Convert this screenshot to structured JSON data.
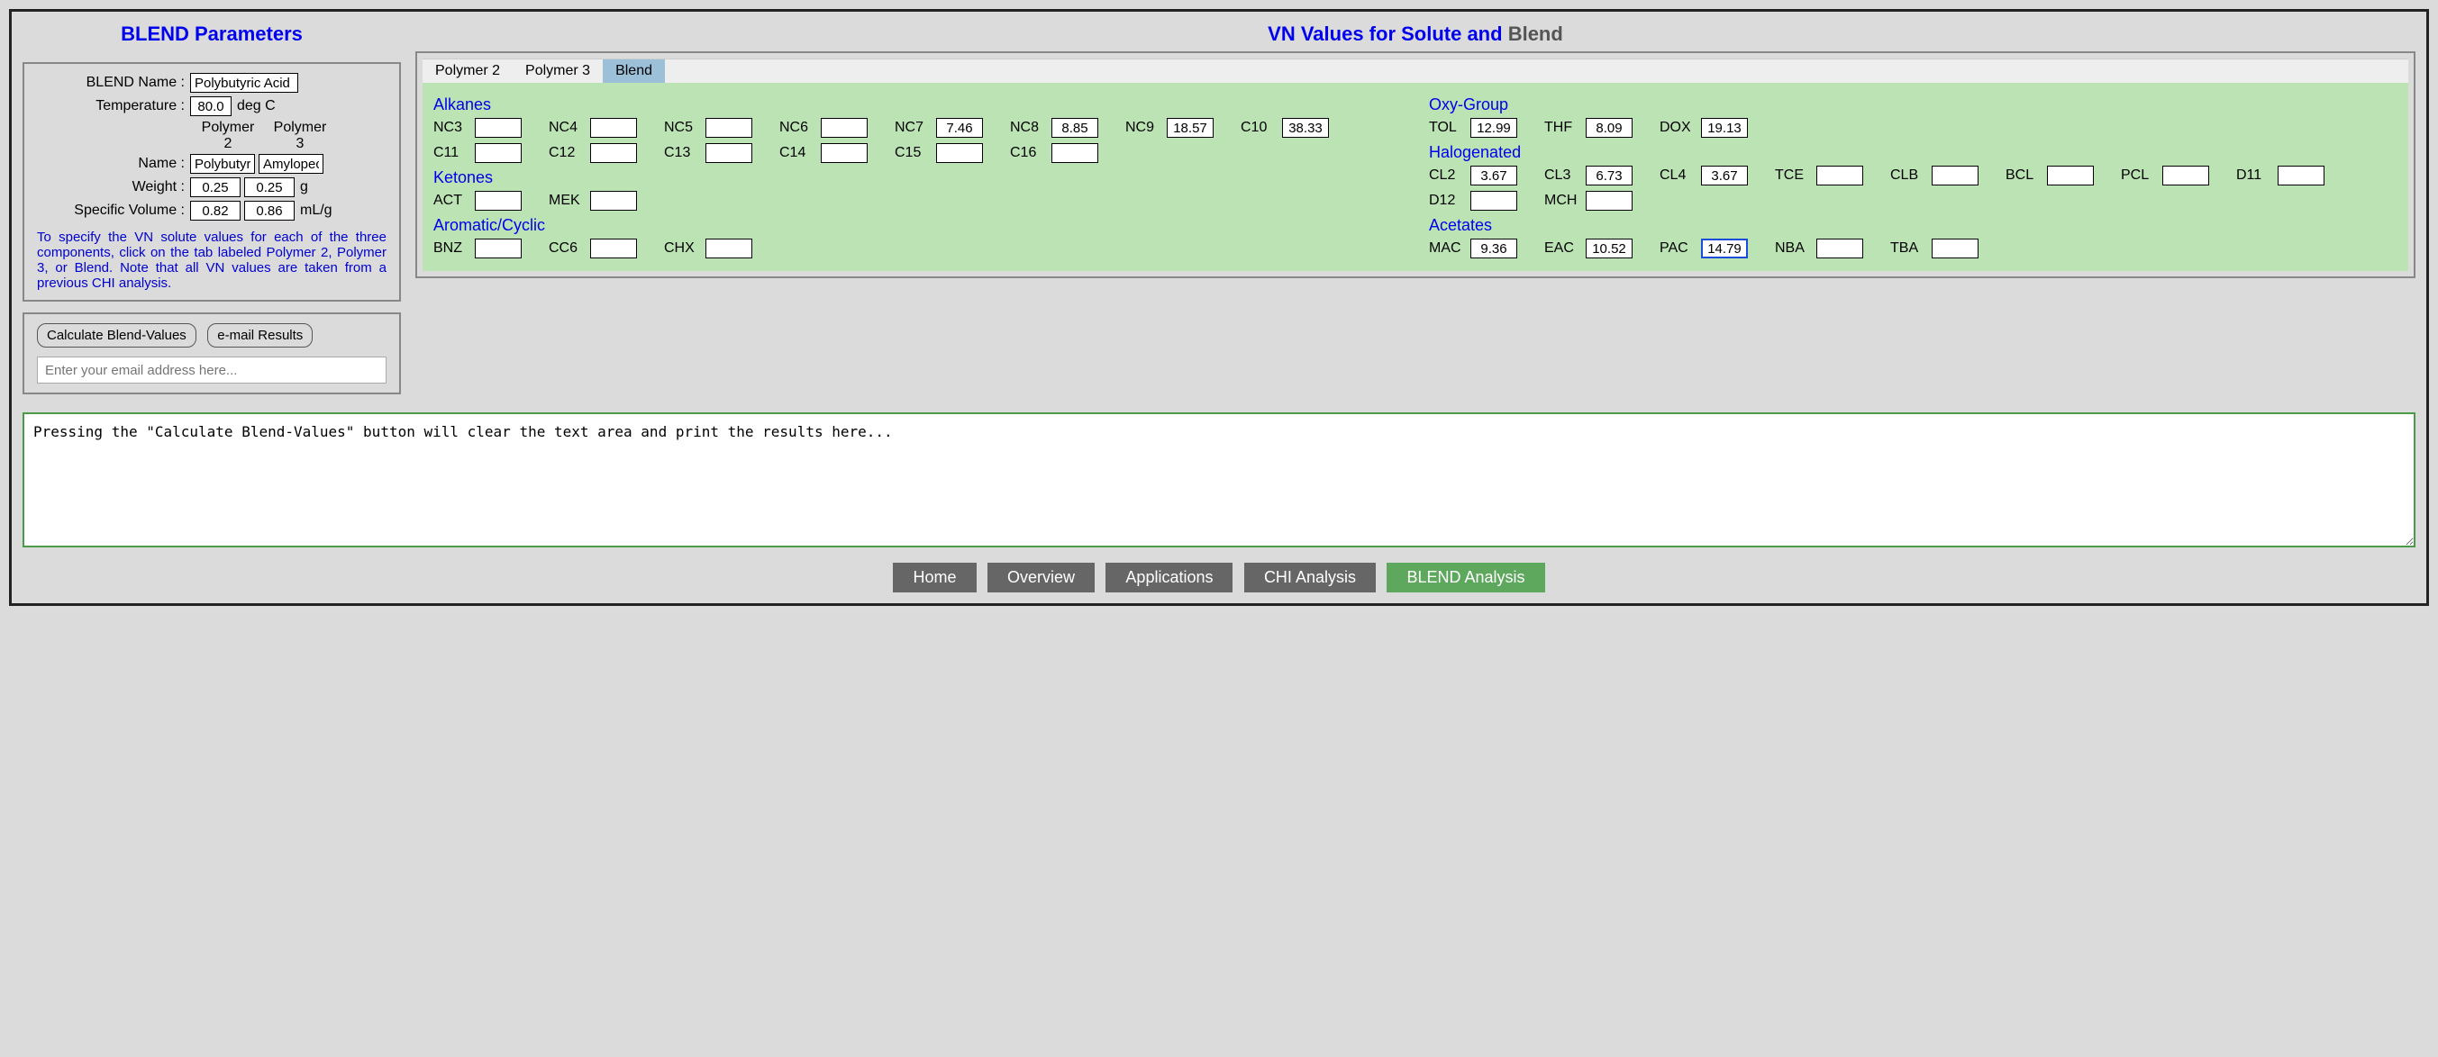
{
  "left": {
    "title": "BLEND Parameters",
    "labels": {
      "blend_name": "BLEND Name :",
      "temperature": "Temperature :",
      "name": "Name :",
      "weight": "Weight :",
      "spec_vol": "Specific Volume :",
      "deg_c": "deg C",
      "g": "g",
      "mlg": "mL/g",
      "poly2": "Polymer 2",
      "poly3": "Polymer 3"
    },
    "values": {
      "blend_name": "Polybutyric Acid",
      "temperature": "80.0",
      "name_p2": "Polybutyr",
      "name_p3": "Amylopec",
      "weight_p2": "0.25",
      "weight_p3": "0.25",
      "sv_p2": "0.82",
      "sv_p3": "0.86"
    },
    "note": "To specify the VN solute values for each of the three components, click on the tab labeled Polymer 2, Polymer 3, or Blend. Note that all VN values are taken from a previous CHI analysis.",
    "buttons": {
      "calc": "Calculate Blend-Values",
      "email": "e-mail Results"
    },
    "email_placeholder": "Enter your email address here..."
  },
  "right": {
    "title_blue": "VN Values for Solute and ",
    "title_grey": "Blend",
    "tabs": [
      "Polymer 2",
      "Polymer 3",
      "Blend"
    ],
    "groups": {
      "alkanes": "Alkanes",
      "ketones": "Ketones",
      "aromatic": "Aromatic/Cyclic",
      "oxy": "Oxy-Group",
      "halog": "Halogenated",
      "acetates": "Acetates"
    },
    "vn": {
      "NC3": "",
      "NC4": "",
      "NC5": "",
      "NC6": "",
      "NC7": "7.46",
      "NC8": "8.85",
      "NC9": "18.57",
      "C10": "38.33",
      "C11": "",
      "C12": "",
      "C13": "",
      "C14": "",
      "C15": "",
      "C16": "",
      "ACT": "",
      "MEK": "",
      "BNZ": "",
      "CC6": "",
      "CHX": "",
      "TOL": "12.99",
      "THF": "8.09",
      "DOX": "19.13",
      "CL2": "3.67",
      "CL3": "6.73",
      "CL4": "3.67",
      "TCE": "",
      "CLB": "",
      "BCL": "",
      "PCL": "",
      "D11": "",
      "D12": "",
      "MCH": "",
      "MAC": "9.36",
      "EAC": "10.52",
      "PAC": "14.79",
      "NBA": "",
      "TBA": ""
    }
  },
  "results_placeholder": "Pressing the \"Calculate Blend-Values\" button will clear the text area and print the results here...",
  "nav": [
    "Home",
    "Overview",
    "Applications",
    "CHI Analysis",
    "BLEND Analysis"
  ]
}
